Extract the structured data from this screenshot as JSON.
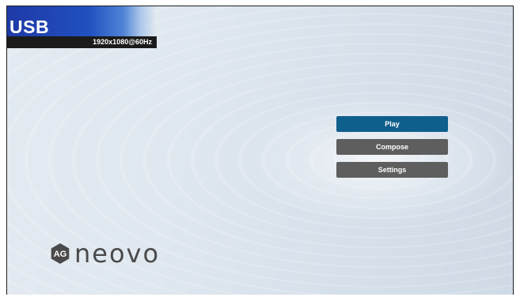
{
  "source": {
    "title": "USB",
    "resolution": "1920x1080@60Hz"
  },
  "menu": {
    "items": [
      {
        "label": "Play",
        "selected": true
      },
      {
        "label": "Compose",
        "selected": false
      },
      {
        "label": "Settings",
        "selected": false
      }
    ]
  },
  "brand": {
    "badge_text": "AG",
    "wordmark": "neovo",
    "color": "#4a4a4a"
  },
  "colors": {
    "selected_button": "#0f5f8c",
    "normal_button": "#5e5e5e",
    "banner": "#2150bf"
  }
}
